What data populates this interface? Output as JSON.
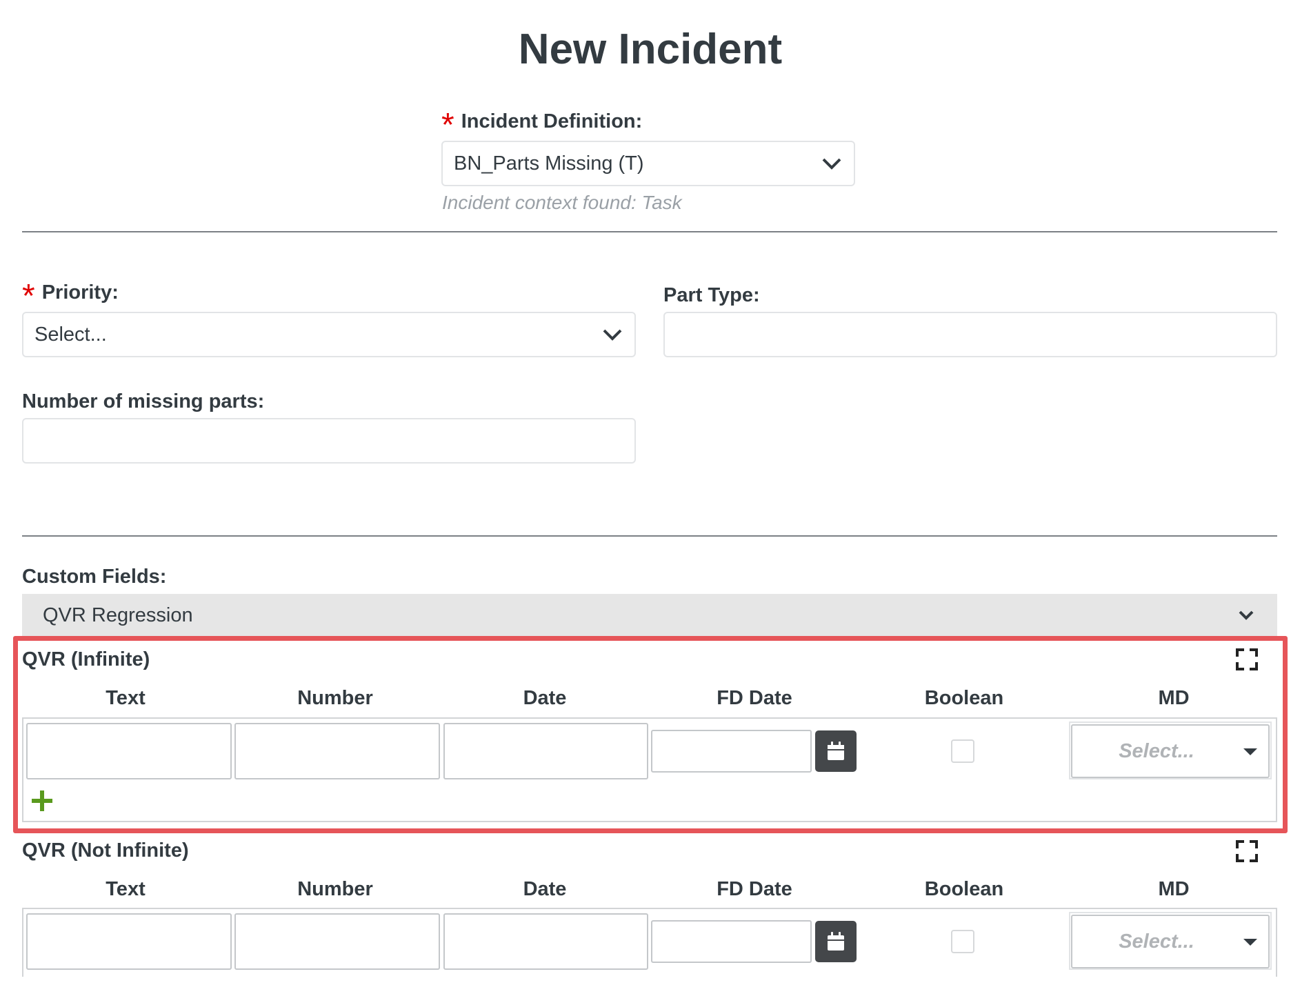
{
  "page": {
    "title": "New Incident"
  },
  "incident_definition": {
    "label": "Incident Definition:",
    "value": "BN_Parts Missing (T)",
    "hint": "Incident context found: Task"
  },
  "priority": {
    "label": "Priority:",
    "value": "Select..."
  },
  "part_type": {
    "label": "Part Type:",
    "value": ""
  },
  "missing_parts": {
    "label": "Number of missing parts:",
    "value": ""
  },
  "custom_fields": {
    "label": "Custom Fields:",
    "selected": "QVR Regression"
  },
  "qvr_infinite": {
    "title": "QVR (Infinite)",
    "columns": [
      "Text",
      "Number",
      "Date",
      "FD Date",
      "Boolean",
      "MD"
    ],
    "md_placeholder": "Select..."
  },
  "qvr_not_infinite": {
    "title": "QVR (Not Infinite)",
    "columns": [
      "Text",
      "Number",
      "Date",
      "FD Date",
      "Boolean",
      "MD"
    ],
    "md_placeholder": "Select..."
  },
  "icons": {
    "dropdown": "chevron-down-icon",
    "expand": "expand-icon",
    "calendar": "calendar-icon",
    "add": "plus-icon"
  },
  "colors": {
    "required": "#e00000",
    "highlight": "#e65559",
    "add": "#5a9a1e",
    "calendar_button": "#44474a"
  }
}
